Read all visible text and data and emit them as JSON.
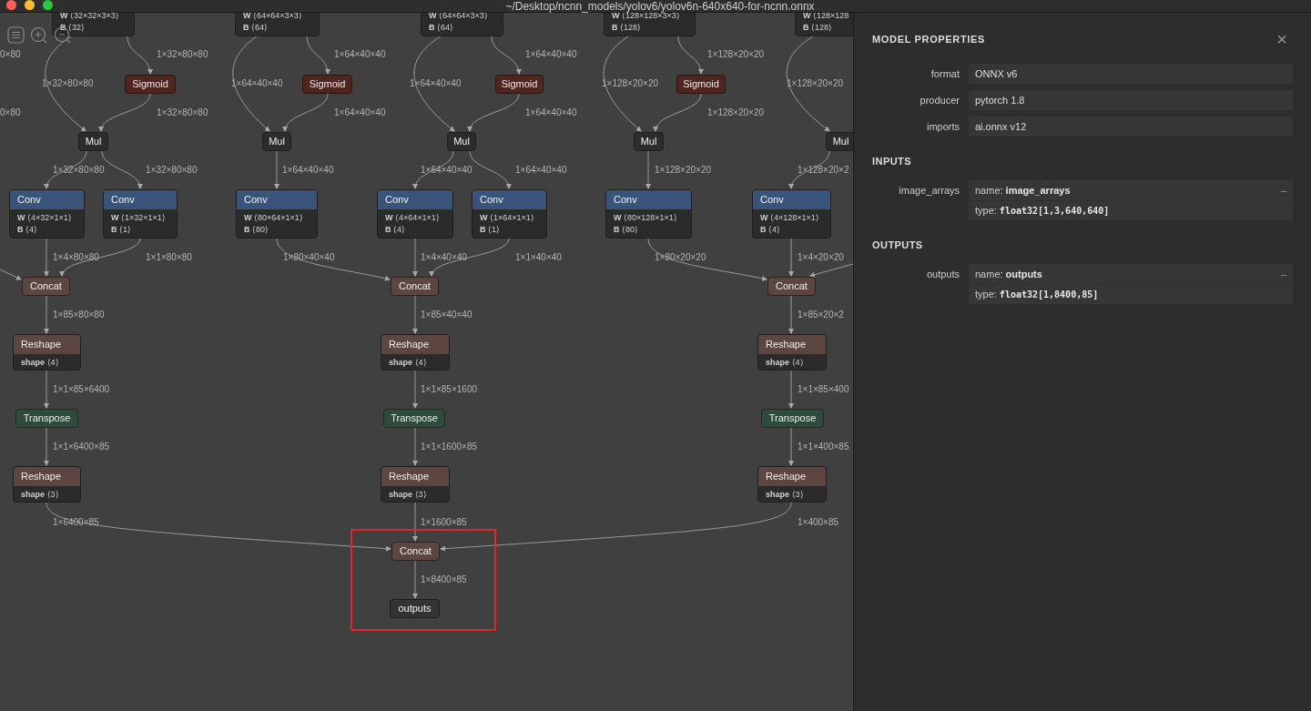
{
  "window": {
    "title": "~/Desktop/ncnn_models/yolov6/yolov6n-640x640-for-ncnn.onnx"
  },
  "graph": {
    "nodes": [
      {
        "kind": "partial",
        "attributes": [
          "**W** ⟨32×32×3×3⟩",
          "**B** ⟨32⟩"
        ]
      },
      {
        "kind": "partial",
        "attributes": [
          "**W** ⟨64×64×3×3⟩",
          "**B** ⟨64⟩"
        ]
      },
      {
        "kind": "partial",
        "attributes": [
          "**W** ⟨64×64×3×3⟩",
          "**B** ⟨64⟩"
        ]
      },
      {
        "kind": "partial",
        "attributes": [
          "**W** ⟨128×128×3×3⟩",
          "**B** ⟨128⟩"
        ]
      },
      {
        "kind": "partial",
        "attributes": [
          "**W** ⟨128×128",
          "**B** ⟨128⟩"
        ]
      },
      {
        "kind": "sigmoid",
        "title": "Sigmoid"
      },
      {
        "kind": "sigmoid",
        "title": "Sigmoid"
      },
      {
        "kind": "sigmoid",
        "title": "Sigmoid"
      },
      {
        "kind": "sigmoid",
        "title": "Sigmoid"
      },
      {
        "kind": "mul",
        "title": "Mul"
      },
      {
        "kind": "mul",
        "title": "Mul"
      },
      {
        "kind": "mul",
        "title": "Mul"
      },
      {
        "kind": "mul",
        "title": "Mul"
      },
      {
        "kind": "mul",
        "title": "Mul"
      },
      {
        "kind": "conv",
        "title": "Conv",
        "attributes": [
          "**W** ⟨4×32×1×1⟩",
          "**B** ⟨4⟩"
        ]
      },
      {
        "kind": "conv",
        "title": "Conv",
        "attributes": [
          "**W** ⟨1×32×1×1⟩",
          "**B** ⟨1⟩"
        ]
      },
      {
        "kind": "conv",
        "title": "Conv",
        "attributes": [
          "**W** ⟨80×64×1×1⟩",
          "**B** ⟨80⟩"
        ]
      },
      {
        "kind": "conv",
        "title": "Conv",
        "attributes": [
          "**W** ⟨4×64×1×1⟩",
          "**B** ⟨4⟩"
        ]
      },
      {
        "kind": "conv",
        "title": "Conv",
        "attributes": [
          "**W** ⟨1×64×1×1⟩",
          "**B** ⟨1⟩"
        ]
      },
      {
        "kind": "conv",
        "title": "Conv",
        "attributes": [
          "**W** ⟨80×128×1×1⟩",
          "**B** ⟨80⟩"
        ]
      },
      {
        "kind": "conv",
        "title": "Conv",
        "attributes": [
          "**W** ⟨4×128×1×1⟩",
          "**B** ⟨4⟩"
        ]
      },
      {
        "kind": "concat",
        "title": "Concat"
      },
      {
        "kind": "concat",
        "title": "Concat"
      },
      {
        "kind": "concat",
        "title": "Concat"
      },
      {
        "kind": "reshape",
        "title": "Reshape",
        "attributes": [
          "**shape** ⟨4⟩"
        ]
      },
      {
        "kind": "reshape",
        "title": "Reshape",
        "attributes": [
          "**shape** ⟨4⟩"
        ]
      },
      {
        "kind": "reshape",
        "title": "Reshape",
        "attributes": [
          "**shape** ⟨4⟩"
        ]
      },
      {
        "kind": "transpose",
        "title": "Transpose"
      },
      {
        "kind": "transpose",
        "title": "Transpose"
      },
      {
        "kind": "transpose",
        "title": "Transpose"
      },
      {
        "kind": "reshape",
        "title": "Reshape",
        "attributes": [
          "**shape** ⟨3⟩"
        ]
      },
      {
        "kind": "reshape",
        "title": "Reshape",
        "attributes": [
          "**shape** ⟨3⟩"
        ]
      },
      {
        "kind": "reshape",
        "title": "Reshape",
        "attributes": [
          "**shape** ⟨3⟩"
        ]
      },
      {
        "kind": "concat",
        "title": "Concat"
      },
      {
        "kind": "output",
        "title": "outputs"
      }
    ],
    "edge_labels": [
      "0×80",
      "1×32×80×80",
      "1×64×40×40",
      "1×64×40×40",
      "1×128×20×20",
      "1×32×80×80",
      "1×64×40×40",
      "1×64×40×40",
      "1×128×20×20",
      "1×128×20×20",
      "0×80",
      "1×32×80×80",
      "1×64×40×40",
      "1×64×40×40",
      "1×128×20×20",
      "1×32×80×80",
      "1×32×80×80",
      "1×64×40×40",
      "1×64×40×40",
      "1×64×40×40",
      "1×128×20×20",
      "1×128×20×2",
      "1×4×80×80",
      "1×1×80×80",
      "1×80×40×40",
      "1×4×40×40",
      "1×1×40×40",
      "1×80×20×20",
      "1×4×20×20",
      "1×85×80×80",
      "1×85×40×40",
      "1×85×20×2",
      "1×1×85×6400",
      "1×1×85×1600",
      "1×1×85×400",
      "1×1×6400×85",
      "1×1×1600×85",
      "1×1×400×85",
      "1×6400×85",
      "1×1600×85",
      "1×400×85",
      "1×8400×85"
    ]
  },
  "properties_panel": {
    "title": "MODEL PROPERTIES",
    "close": "×",
    "fields": [
      {
        "label": "format",
        "value": "ONNX v6"
      },
      {
        "label": "producer",
        "value": "pytorch 1.8"
      },
      {
        "label": "imports",
        "value": "ai.onnx v12"
      }
    ],
    "sections": [
      {
        "title": "INPUTS",
        "items": [
          {
            "label": "image_arrays",
            "name_label": "name:",
            "name": "image_arrays",
            "type_label": "type:",
            "type": "float32[1,3,640,640]",
            "toggle": "–"
          }
        ]
      },
      {
        "title": "OUTPUTS",
        "items": [
          {
            "label": "outputs",
            "name_label": "name:",
            "name": "outputs",
            "type_label": "type:",
            "type": "float32[1,8400,85]",
            "toggle": "–"
          }
        ]
      }
    ]
  }
}
